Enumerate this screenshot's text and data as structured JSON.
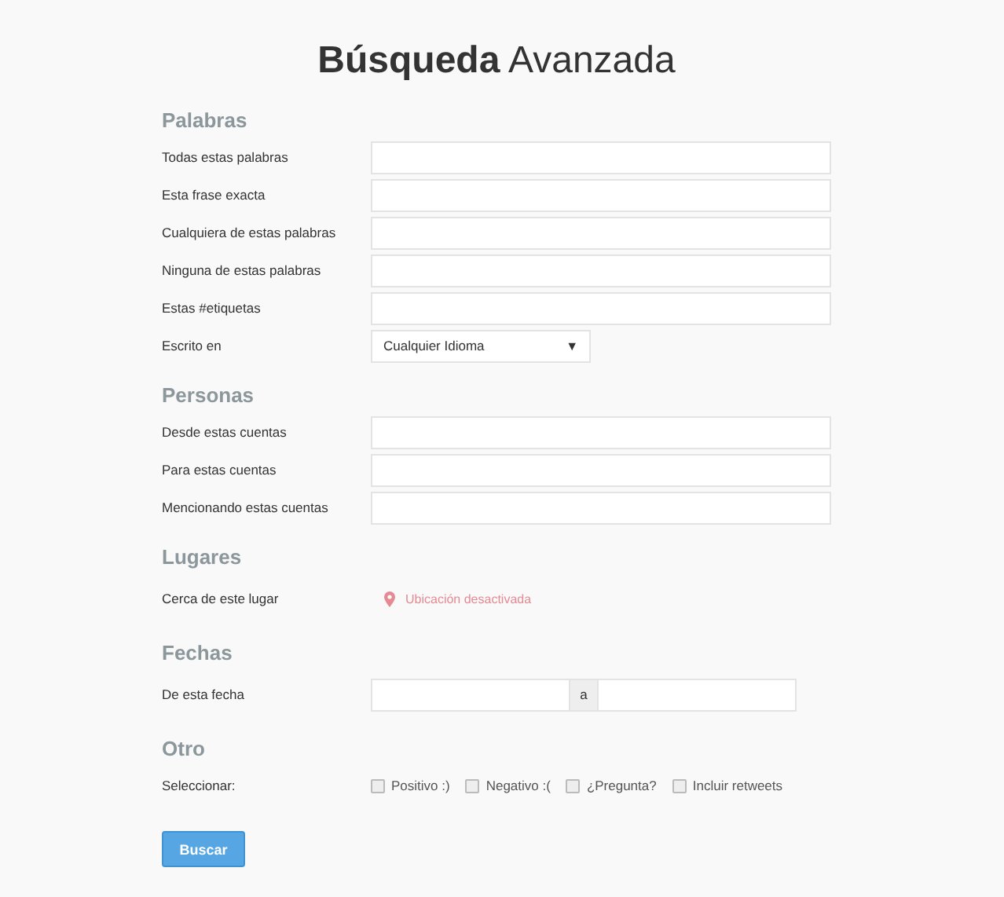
{
  "title": "**Búsqueda** Avanzada",
  "sections": [
    {
      "heading": "Palabras",
      "rows": [
        {
          "kind": "text",
          "label": "Todas estas palabras"
        },
        {
          "kind": "text",
          "label": "Esta frase exacta"
        },
        {
          "kind": "text",
          "label": "Cualquiera de estas palabras"
        },
        {
          "kind": "text",
          "label": "Ninguna de estas palabras"
        },
        {
          "kind": "text",
          "label": "Estas #etiquetas"
        },
        {
          "kind": "select",
          "label": "Escrito en",
          "value": "Cualquier Idioma",
          "caret": "▼"
        }
      ]
    },
    {
      "heading": "Personas",
      "rows": [
        {
          "kind": "text",
          "label": "Desde estas cuentas"
        },
        {
          "kind": "text",
          "label": "Para estas cuentas"
        },
        {
          "kind": "text",
          "label": "Mencionando estas cuentas"
        }
      ]
    },
    {
      "heading": "Lugares",
      "rows": [
        {
          "kind": "location",
          "label": "Cerca de este lugar",
          "value": "Ubicación desactivada"
        }
      ]
    },
    {
      "heading": "Fechas",
      "rows": [
        {
          "kind": "daterange",
          "label": "De esta fecha",
          "separator": "a"
        }
      ]
    },
    {
      "heading": "Otro",
      "rows": [
        {
          "kind": "checkboxes",
          "label": "Seleccionar:",
          "options": [
            {
              "label": "Positivo :)",
              "checked": false
            },
            {
              "label": "Negativo :(",
              "checked": false
            },
            {
              "label": "¿Pregunta?",
              "checked": false
            },
            {
              "label": "Incluir retweets",
              "checked": false
            }
          ]
        }
      ]
    }
  ],
  "button": "Buscar"
}
